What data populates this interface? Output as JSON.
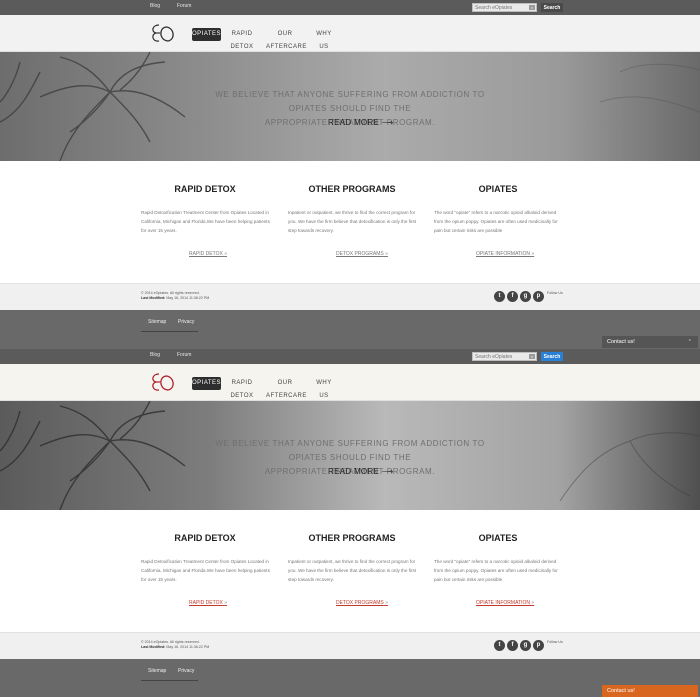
{
  "topbar": {
    "blog": "Blog",
    "forum": "Forum",
    "search_placeholder": "Search eOpiates",
    "search_button": "Search"
  },
  "logo": {
    "text": "EO"
  },
  "nav": {
    "items": [
      "OPIATES",
      "RAPID DETOX",
      "OUR AFTERCARE",
      "WHY US"
    ]
  },
  "hero": {
    "line1": "WE BELIEVE THAT ANYONE SUFFERING FROM ADDICTION TO OPIATES SHOULD FIND THE",
    "line2": "APPROPRIATE TREATMENT PROGRAM.",
    "read_more": "READ MORE",
    "arrow": "⟶"
  },
  "columns": [
    {
      "title": "RAPID DETOX",
      "body": "Rapid Detoxification Treatment Center from Opiates Located in California, Michigan and Florida.We have been helping patients for over 15 years.",
      "link": "RAPID DETOX",
      "arrow": "»"
    },
    {
      "title": "OTHER PROGRAMS",
      "body": "Inpatient or outpatient, we thrive to find the correct program for you. We have the firm believe that detoxification is only the first step towards recovery.",
      "link": "DETOX PROGRAMS",
      "arrow": "»"
    },
    {
      "title": "OPIATES",
      "body": "The word \"opiate\" refers to a narcotic opioid alkaloid derived from the opium poppy. Opiates are often used medicinally for pain but certain risks are possible",
      "link": "OPIATE INFORMATION",
      "arrow": "»"
    }
  ],
  "footer": {
    "copyright": "© 2014 eOpiates. All rights reserved.",
    "last_modified_label": "Last Modified:",
    "last_modified_value": "May 16, 2014 11:36:22 PM",
    "social": [
      "t",
      "f",
      "g",
      "p"
    ],
    "follow": "Follow Us"
  },
  "bottom": {
    "links": [
      "Sitemap",
      "Privacy"
    ]
  },
  "contact": {
    "label": "Contact us!",
    "chevron": "⌃"
  },
  "colors": {
    "contact_active": "#d9661f",
    "search_active": "#2a7fd6",
    "link_hover": "#c0392b"
  }
}
